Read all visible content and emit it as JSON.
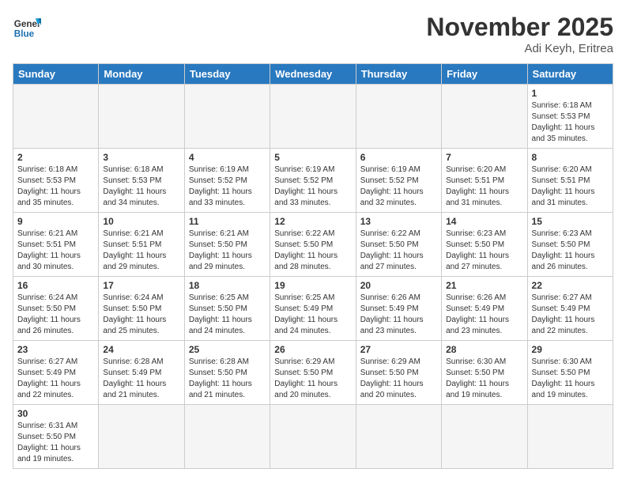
{
  "header": {
    "logo_line1": "General",
    "logo_line2": "Blue",
    "month": "November 2025",
    "location": "Adi Keyh, Eritrea"
  },
  "weekdays": [
    "Sunday",
    "Monday",
    "Tuesday",
    "Wednesday",
    "Thursday",
    "Friday",
    "Saturday"
  ],
  "weeks": [
    [
      {
        "day": "",
        "empty": true
      },
      {
        "day": "",
        "empty": true
      },
      {
        "day": "",
        "empty": true
      },
      {
        "day": "",
        "empty": true
      },
      {
        "day": "",
        "empty": true
      },
      {
        "day": "",
        "empty": true
      },
      {
        "day": "1",
        "sunrise": "6:18 AM",
        "sunset": "5:53 PM",
        "daylight": "11 hours and 35 minutes."
      }
    ],
    [
      {
        "day": "2",
        "sunrise": "6:18 AM",
        "sunset": "5:53 PM",
        "daylight": "11 hours and 35 minutes."
      },
      {
        "day": "3",
        "sunrise": "6:18 AM",
        "sunset": "5:53 PM",
        "daylight": "11 hours and 34 minutes."
      },
      {
        "day": "4",
        "sunrise": "6:19 AM",
        "sunset": "5:52 PM",
        "daylight": "11 hours and 33 minutes."
      },
      {
        "day": "5",
        "sunrise": "6:19 AM",
        "sunset": "5:52 PM",
        "daylight": "11 hours and 33 minutes."
      },
      {
        "day": "6",
        "sunrise": "6:19 AM",
        "sunset": "5:52 PM",
        "daylight": "11 hours and 32 minutes."
      },
      {
        "day": "7",
        "sunrise": "6:20 AM",
        "sunset": "5:51 PM",
        "daylight": "11 hours and 31 minutes."
      },
      {
        "day": "8",
        "sunrise": "6:20 AM",
        "sunset": "5:51 PM",
        "daylight": "11 hours and 31 minutes."
      }
    ],
    [
      {
        "day": "9",
        "sunrise": "6:21 AM",
        "sunset": "5:51 PM",
        "daylight": "11 hours and 30 minutes."
      },
      {
        "day": "10",
        "sunrise": "6:21 AM",
        "sunset": "5:51 PM",
        "daylight": "11 hours and 29 minutes."
      },
      {
        "day": "11",
        "sunrise": "6:21 AM",
        "sunset": "5:50 PM",
        "daylight": "11 hours and 29 minutes."
      },
      {
        "day": "12",
        "sunrise": "6:22 AM",
        "sunset": "5:50 PM",
        "daylight": "11 hours and 28 minutes."
      },
      {
        "day": "13",
        "sunrise": "6:22 AM",
        "sunset": "5:50 PM",
        "daylight": "11 hours and 27 minutes."
      },
      {
        "day": "14",
        "sunrise": "6:23 AM",
        "sunset": "5:50 PM",
        "daylight": "11 hours and 27 minutes."
      },
      {
        "day": "15",
        "sunrise": "6:23 AM",
        "sunset": "5:50 PM",
        "daylight": "11 hours and 26 minutes."
      }
    ],
    [
      {
        "day": "16",
        "sunrise": "6:24 AM",
        "sunset": "5:50 PM",
        "daylight": "11 hours and 26 minutes."
      },
      {
        "day": "17",
        "sunrise": "6:24 AM",
        "sunset": "5:50 PM",
        "daylight": "11 hours and 25 minutes."
      },
      {
        "day": "18",
        "sunrise": "6:25 AM",
        "sunset": "5:50 PM",
        "daylight": "11 hours and 24 minutes."
      },
      {
        "day": "19",
        "sunrise": "6:25 AM",
        "sunset": "5:49 PM",
        "daylight": "11 hours and 24 minutes."
      },
      {
        "day": "20",
        "sunrise": "6:26 AM",
        "sunset": "5:49 PM",
        "daylight": "11 hours and 23 minutes."
      },
      {
        "day": "21",
        "sunrise": "6:26 AM",
        "sunset": "5:49 PM",
        "daylight": "11 hours and 23 minutes."
      },
      {
        "day": "22",
        "sunrise": "6:27 AM",
        "sunset": "5:49 PM",
        "daylight": "11 hours and 22 minutes."
      }
    ],
    [
      {
        "day": "23",
        "sunrise": "6:27 AM",
        "sunset": "5:49 PM",
        "daylight": "11 hours and 22 minutes."
      },
      {
        "day": "24",
        "sunrise": "6:28 AM",
        "sunset": "5:49 PM",
        "daylight": "11 hours and 21 minutes."
      },
      {
        "day": "25",
        "sunrise": "6:28 AM",
        "sunset": "5:50 PM",
        "daylight": "11 hours and 21 minutes."
      },
      {
        "day": "26",
        "sunrise": "6:29 AM",
        "sunset": "5:50 PM",
        "daylight": "11 hours and 20 minutes."
      },
      {
        "day": "27",
        "sunrise": "6:29 AM",
        "sunset": "5:50 PM",
        "daylight": "11 hours and 20 minutes."
      },
      {
        "day": "28",
        "sunrise": "6:30 AM",
        "sunset": "5:50 PM",
        "daylight": "11 hours and 19 minutes."
      },
      {
        "day": "29",
        "sunrise": "6:30 AM",
        "sunset": "5:50 PM",
        "daylight": "11 hours and 19 minutes."
      }
    ],
    [
      {
        "day": "30",
        "sunrise": "6:31 AM",
        "sunset": "5:50 PM",
        "daylight": "11 hours and 19 minutes."
      },
      {
        "day": "",
        "empty": true
      },
      {
        "day": "",
        "empty": true
      },
      {
        "day": "",
        "empty": true
      },
      {
        "day": "",
        "empty": true
      },
      {
        "day": "",
        "empty": true
      },
      {
        "day": "",
        "empty": true
      }
    ]
  ]
}
